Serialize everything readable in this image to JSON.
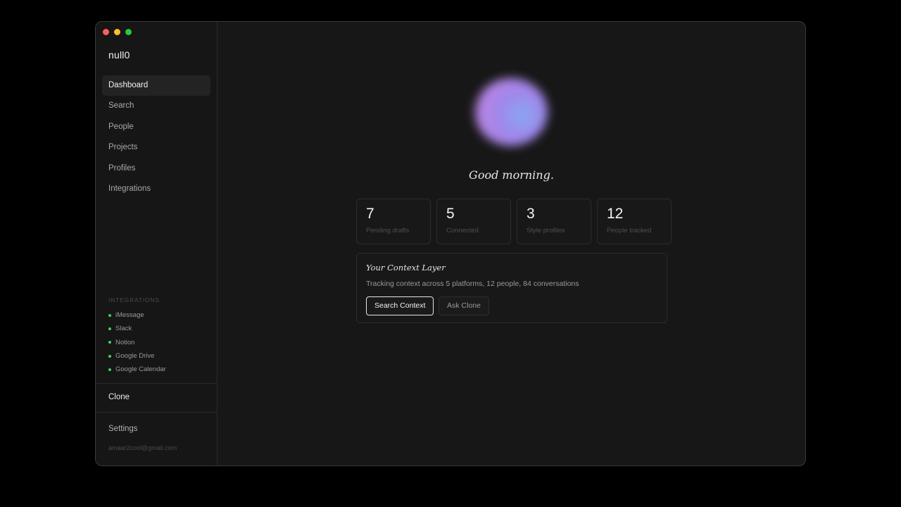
{
  "app": {
    "name": "null0"
  },
  "sidebar": {
    "nav": [
      {
        "label": "Dashboard",
        "active": true
      },
      {
        "label": "Search"
      },
      {
        "label": "People"
      },
      {
        "label": "Projects"
      },
      {
        "label": "Profiles"
      },
      {
        "label": "Integrations"
      }
    ],
    "integrations_heading": "INTEGRATIONS",
    "integrations": [
      {
        "label": "iMessage",
        "status": "connected"
      },
      {
        "label": "Slack",
        "status": "connected"
      },
      {
        "label": "Notion",
        "status": "connected"
      },
      {
        "label": "Google Drive",
        "status": "connected"
      },
      {
        "label": "Google Calendar",
        "status": "connected"
      }
    ],
    "clone_label": "Clone",
    "settings_label": "Settings",
    "user_email": "amaar2cool@gmail.com"
  },
  "main": {
    "greeting": "Good morning.",
    "stats": [
      {
        "value": "7",
        "label": "Pending drafts"
      },
      {
        "value": "5",
        "label": "Connected"
      },
      {
        "value": "3",
        "label": "Style profiles"
      },
      {
        "value": "12",
        "label": "People tracked"
      }
    ],
    "context": {
      "title": "Your Context Layer",
      "description": "Tracking context across 5 platforms, 12 people, 84 conversations",
      "primary_button": "Search Context",
      "secondary_button": "Ask Clone"
    }
  },
  "colors": {
    "background": "#000000",
    "window": "#171717",
    "status_dot": "#3ecf6a",
    "orb_start": "#c08cf0",
    "orb_end": "#8fb0ff"
  }
}
